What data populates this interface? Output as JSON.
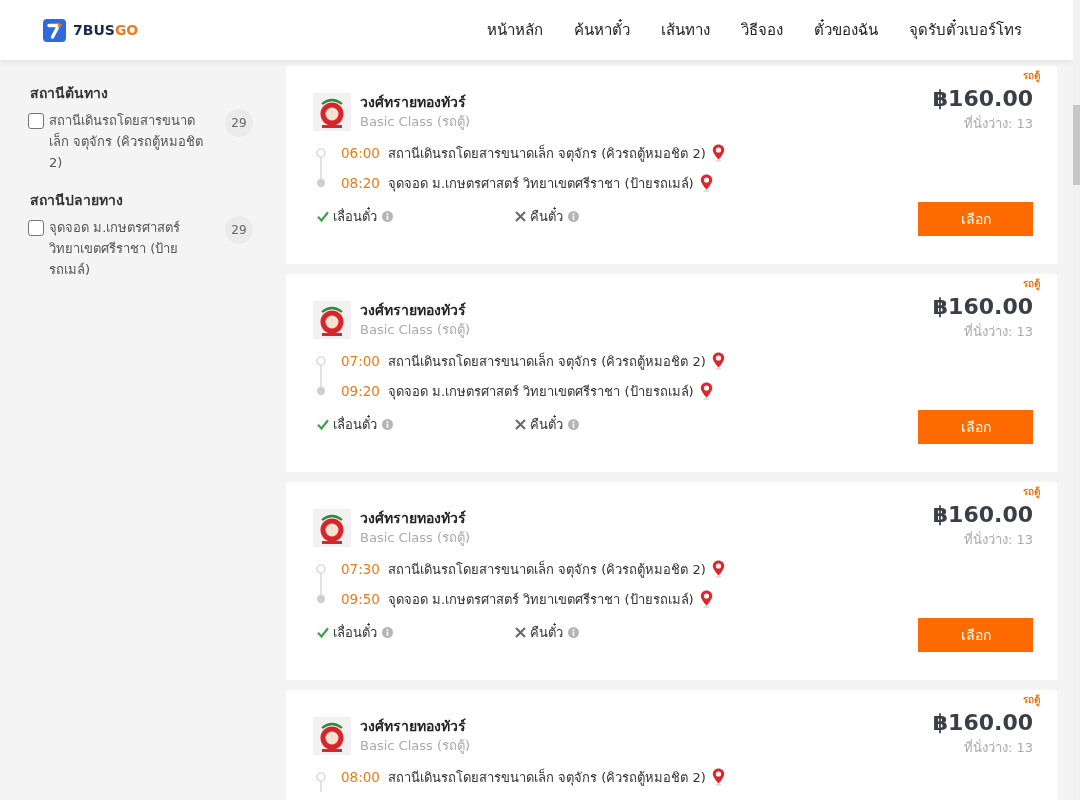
{
  "header": {
    "brand": {
      "name_main": "7BUS",
      "name_accent": "GO"
    },
    "nav": [
      {
        "label": "หน้าหลัก"
      },
      {
        "label": "ค้นหาตั๋ว"
      },
      {
        "label": "เส้นทาง"
      },
      {
        "label": "วิธีจอง"
      },
      {
        "label": "ตั๋วของฉัน"
      },
      {
        "label": "จุดรับตั๋วเบอร์โทร"
      }
    ]
  },
  "sidebar": {
    "filters": [
      {
        "title": "สถานีต้นทาง",
        "options": [
          {
            "label": "สถานีเดินรถโดยสารขนาดเล็ก จตุจักร (คิวรถตู้หมอชิต 2)",
            "count": "29",
            "checked": false
          }
        ]
      },
      {
        "title": "สถานีปลายทาง",
        "options": [
          {
            "label": "จุดจอด ม.เกษตรศาสตร์ วิทยาเขตศรีราชา (ป้ายรถเมล์)",
            "count": "29",
            "checked": false
          }
        ]
      }
    ]
  },
  "trips": [
    {
      "tag": "รถตู้",
      "operator": "วงศ์ทรายทองทัวร์",
      "class": "Basic Class (รถตู้)",
      "price": "฿160.00",
      "seats": "ที่นั่งว่าง: 13",
      "stops": [
        {
          "kind": "departure",
          "time": "06:00",
          "station": "สถานีเดินรถโดยสารขนาดเล็ก จตุจักร (คิวรถตู้หมอชิต 2)"
        },
        {
          "kind": "arrival",
          "time": "08:20",
          "station": "จุดจอด ม.เกษตรศาสตร์ วิทยาเขตศรีราชา (ป้ายรถเมล์)"
        }
      ],
      "features": [
        {
          "label": "เลื่อนตั๋ว",
          "available": true
        },
        {
          "label": "คืนตั๋ว",
          "available": false
        }
      ],
      "button": "เลือก"
    },
    {
      "tag": "รถตู้",
      "operator": "วงศ์ทรายทองทัวร์",
      "class": "Basic Class (รถตู้)",
      "price": "฿160.00",
      "seats": "ที่นั่งว่าง: 13",
      "stops": [
        {
          "kind": "departure",
          "time": "07:00",
          "station": "สถานีเดินรถโดยสารขนาดเล็ก จตุจักร (คิวรถตู้หมอชิต 2)"
        },
        {
          "kind": "arrival",
          "time": "09:20",
          "station": "จุดจอด ม.เกษตรศาสตร์ วิทยาเขตศรีราชา (ป้ายรถเมล์)"
        }
      ],
      "features": [
        {
          "label": "เลื่อนตั๋ว",
          "available": true
        },
        {
          "label": "คืนตั๋ว",
          "available": false
        }
      ],
      "button": "เลือก"
    },
    {
      "tag": "รถตู้",
      "operator": "วงศ์ทรายทองทัวร์",
      "class": "Basic Class (รถตู้)",
      "price": "฿160.00",
      "seats": "ที่นั่งว่าง: 13",
      "stops": [
        {
          "kind": "departure",
          "time": "07:30",
          "station": "สถานีเดินรถโดยสารขนาดเล็ก จตุจักร (คิวรถตู้หมอชิต 2)"
        },
        {
          "kind": "arrival",
          "time": "09:50",
          "station": "จุดจอด ม.เกษตรศาสตร์ วิทยาเขตศรีราชา (ป้ายรถเมล์)"
        }
      ],
      "features": [
        {
          "label": "เลื่อนตั๋ว",
          "available": true
        },
        {
          "label": "คืนตั๋ว",
          "available": false
        }
      ],
      "button": "เลือก"
    },
    {
      "tag": "รถตู้",
      "operator": "วงศ์ทรายทองทัวร์",
      "class": "Basic Class (รถตู้)",
      "price": "฿160.00",
      "seats": "ที่นั่งว่าง: 13",
      "stops": [
        {
          "kind": "departure",
          "time": "08:00",
          "station": "สถานีเดินรถโดยสารขนาดเล็ก จตุจักร (คิวรถตู้หมอชิต 2)"
        }
      ]
    }
  ]
}
